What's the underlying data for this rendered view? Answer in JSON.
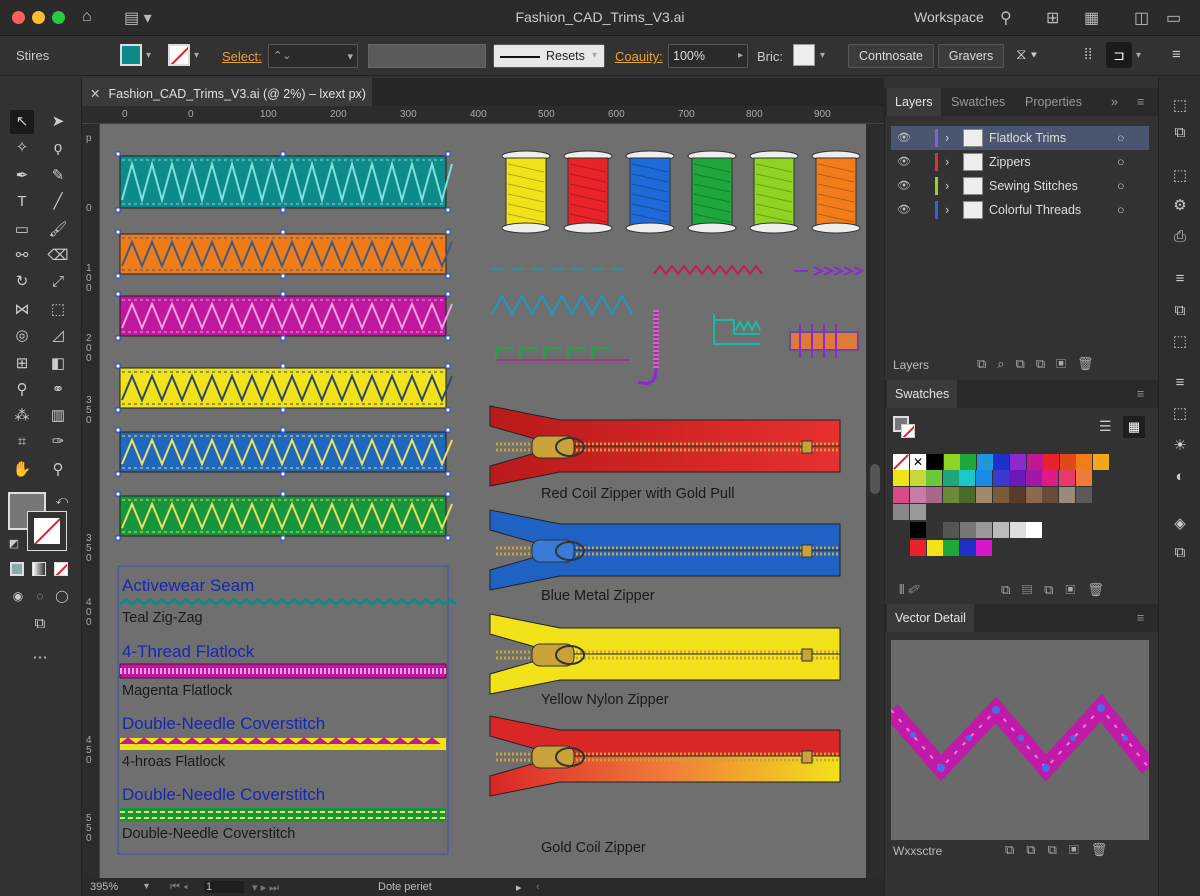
{
  "window": {
    "title": "Fashion_CAD_Trims_V3.ai",
    "workspace_label": "Workspace"
  },
  "control_bar": {
    "selection_label": "Stires",
    "select_label": "Select:",
    "stroke_style_label": "Resets",
    "opacity_label": "Coauity:",
    "opacity_value": "100%",
    "brightness_label": "Bric:",
    "button_1": "Contnosate",
    "button_2": "Gravers"
  },
  "document_tab": {
    "label": "Fashion_CAD_Trims_V3.ai (@ 2%) – Ɩxext px)"
  },
  "ruler": {
    "top_labels": [
      "0",
      "0",
      "100",
      "200",
      "300",
      "400",
      "500",
      "600",
      "700",
      "800",
      "900"
    ],
    "left_labels": [
      "p",
      "0",
      "1 0 0",
      "2 0 0",
      "3 5 0",
      "3 5 0",
      "4 0 0",
      "4 5 0",
      "5 5 0",
      "1 5 0"
    ]
  },
  "canvas": {
    "trim_bands": [
      {
        "name": "teal",
        "bg": "#0e8a8a",
        "stitch": "#7be0de"
      },
      {
        "name": "orange",
        "bg": "#f07c18",
        "stitch": "#3a5a8a"
      },
      {
        "name": "magenta",
        "bg": "#c0189c",
        "stitch": "#f0a0e8"
      },
      {
        "name": "yellow",
        "bg": "#f2e21a",
        "stitch": "#2a4a6a"
      },
      {
        "name": "blue",
        "bg": "#1e68c0",
        "stitch": "#f0e060"
      },
      {
        "name": "green",
        "bg": "#16963c",
        "stitch": "#e8e060"
      }
    ],
    "labels": {
      "activewear_seam": "Activewear Seam",
      "teal_zigzag": "Teal Zig-Zag",
      "four_thread_flatlock": "4-Thread Flatlock",
      "magenta_flatlock": "Magenta Flatlock",
      "double_needle_1": "Double-Needle Coverstitch",
      "four_hroas": "4-hroas Flatlock",
      "double_needle_2": "Double-Needle Coverstitch",
      "double_needle_3": "Double-Needle Coverstitch"
    },
    "spool_colors": [
      "#f2e21a",
      "#e8232a",
      "#1e6ad8",
      "#1ea83c",
      "#8fd422",
      "#f27c1a"
    ],
    "zippers": [
      {
        "label": "Red Coil Zipper with Gold Pull",
        "tape": "#d92626",
        "puller": "#c9a23a"
      },
      {
        "label": "Blue Metal Zipper",
        "tape": "#1f62c4",
        "puller": "#3a7ad8"
      },
      {
        "label": "Yellow Nylon Zipper",
        "tape": "#f2e21a",
        "puller": "#c9a23a"
      },
      {
        "label": "Gold Coil Zipper",
        "tape": "#d92626",
        "puller": "#c9a23a"
      }
    ]
  },
  "status": {
    "zoom": "395%",
    "page": "1",
    "info": "Dote periet"
  },
  "layers_panel": {
    "tabs": [
      "Layers",
      "Swatches",
      "Properties"
    ],
    "rows": [
      {
        "name": "Flatlock Trims",
        "color": "#8a5cd6"
      },
      {
        "name": "Zippers",
        "color": "#e03030"
      },
      {
        "name": "Sewing Stitches",
        "color": "#8fd422"
      },
      {
        "name": "Colorful Threads",
        "color": "#3060e0"
      }
    ],
    "footer": "Layers"
  },
  "swatches_panel": {
    "title": "Swatches",
    "row1": [
      "#ffffff",
      "#000000",
      "#8fd422",
      "#1ea83c",
      "#1e98d8",
      "#1e30c8",
      "#8a2ad0",
      "#c01890",
      "#e8232a",
      "#e04a1a",
      "#f27c1a",
      "#f2a81a"
    ],
    "row2": [
      "#f2e21a",
      "#c8d83a",
      "#6ac83a",
      "#1ea878",
      "#1ac8c8",
      "#1a8ae8",
      "#3a3ad0",
      "#6a1ab8",
      "#a018a8",
      "#e01888",
      "#e83a6a",
      "#f07a3a"
    ],
    "row3": [
      "#d84a8a",
      "#c87aa8",
      "#a8688a",
      "#6a8a3a",
      "#4a6a2a",
      "#a08a6a",
      "#7a5a3a",
      "#5a3a2a",
      "#8a6a4a",
      "#6a4a3a",
      "#9a8a7a",
      "#5a5a5a"
    ],
    "row4": [
      "#888888",
      "#9a9a9a"
    ],
    "row5": [
      "#000000",
      "#333333",
      "#555555",
      "#777777",
      "#999999",
      "#bbbbbb",
      "#dddddd",
      "#ffffff"
    ],
    "row6": [
      "#e8232a",
      "#f2e21a",
      "#1ea83c",
      "#1e30c8",
      "#d818c8"
    ]
  },
  "vector_panel": {
    "title": "Vector Detail",
    "footer": "Wxxsctre"
  }
}
